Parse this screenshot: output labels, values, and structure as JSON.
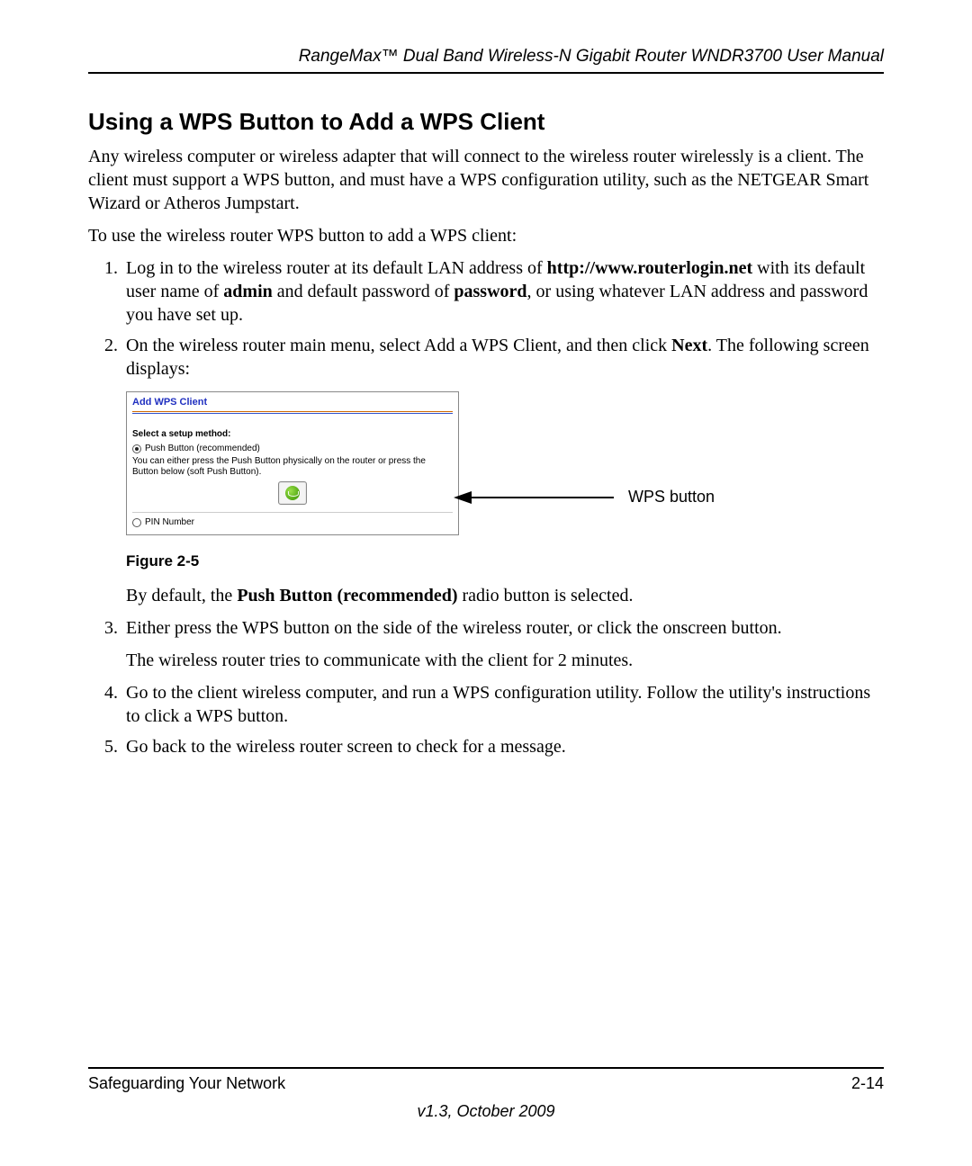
{
  "header": {
    "manual_title": "RangeMax™ Dual Band Wireless-N Gigabit Router WNDR3700 User Manual"
  },
  "section": {
    "title": "Using a WPS Button to Add a WPS Client",
    "intro": "Any wireless computer or wireless adapter that will connect to the wireless router wirelessly is a client. The client must support a WPS button, and must have a WPS configuration utility, such as the NETGEAR Smart Wizard or Atheros Jumpstart.",
    "lead_in": "To use the wireless router WPS button to add a WPS client:"
  },
  "steps": {
    "s1_a": "Log in to the wireless router at its default LAN address of ",
    "s1_url": "http://www.routerlogin.net",
    "s1_b": " with its default user name of ",
    "s1_admin": "admin",
    "s1_c": " and default password of ",
    "s1_pw": "password",
    "s1_d": ", or using whatever LAN address and password you have set up.",
    "s2_a": "On the wireless router main menu, select Add a WPS Client, and then click ",
    "s2_next": "Next",
    "s2_b": ". The following screen displays:",
    "s2_sub_a": "By default, the ",
    "s2_sub_bold": "Push Button (recommended)",
    "s2_sub_b": " radio button is selected.",
    "s3": "Either press the WPS button on the side of the wireless router, or click the onscreen button.",
    "s3_sub": "The wireless router tries to communicate with the client for 2 minutes.",
    "s4": "Go to the client wireless computer, and run a WPS configuration utility. Follow the utility's instructions to click a WPS button.",
    "s5": "Go back to the wireless router screen to check for a message."
  },
  "dialog": {
    "title": "Add WPS Client",
    "select_label": "Select a setup method:",
    "opt_push": "Push Button (recommended)",
    "push_desc": "You can either press the Push Button physically on the router or press the Button below (soft Push Button).",
    "opt_pin": "PIN Number"
  },
  "callout": {
    "label": "WPS button"
  },
  "figure": {
    "caption": "Figure 2-5"
  },
  "footer": {
    "chapter": "Safeguarding Your Network",
    "page": "2-14",
    "version": "v1.3, October 2009"
  }
}
